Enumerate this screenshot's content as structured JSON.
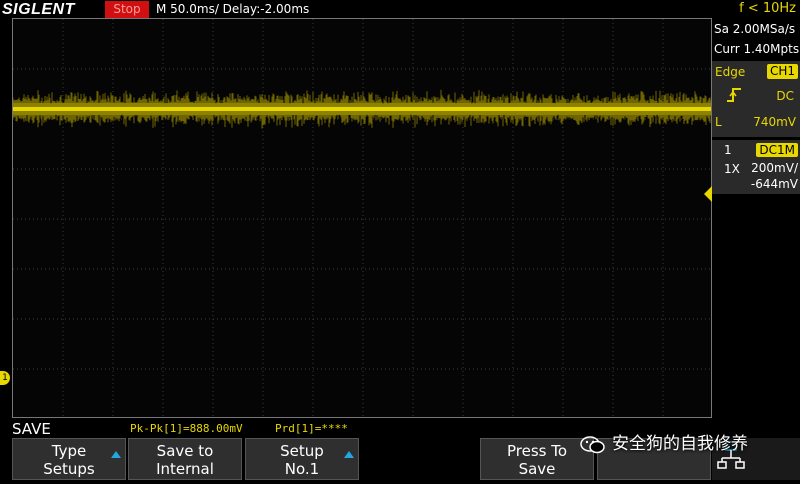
{
  "header": {
    "brand": "SIGLENT",
    "run_status": "Stop",
    "timebase": "M 50.0ms/ Delay:-2.00ms",
    "frequency": "f < 10Hz"
  },
  "acquisition": {
    "sample_rate": "Sa 2.00MSa/s",
    "memory_depth": "Curr 1.40Mpts"
  },
  "trigger": {
    "mode": "Edge",
    "source": "CH1",
    "coupling": "DC",
    "level_label": "L",
    "level": "740mV"
  },
  "channel1": {
    "number": "1",
    "coupling": "DC1M",
    "probe": "1X",
    "scale": "200mV/",
    "offset": "-644mV",
    "marker": "1",
    "trace_color": "#e8d800",
    "trace_level_div": 6.4
  },
  "measurements": {
    "pk_pk": "Pk-Pk[1]=888.00mV",
    "period": "Prd[1]=****"
  },
  "menu": {
    "title": "SAVE",
    "softkeys": [
      {
        "line1": "Type",
        "line2": "Setups",
        "has_arrow": true
      },
      {
        "line1": "Save to",
        "line2": "Internal",
        "has_arrow": false
      },
      {
        "line1": "Setup",
        "line2": "No.1",
        "has_arrow": true
      },
      {
        "line1": "Press To",
        "line2": "Save",
        "has_arrow": false
      }
    ]
  },
  "watermark": {
    "text": "安全狗的自我修养",
    "icon": "wechat-icon"
  },
  "colors": {
    "accent_blue": "#22a7e0",
    "channel_yellow": "#e8d800",
    "stop_red": "#d01010"
  }
}
